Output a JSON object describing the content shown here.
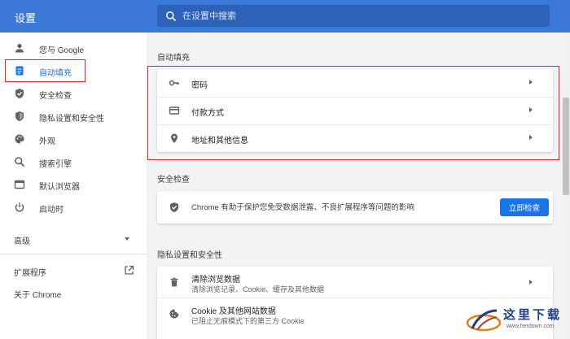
{
  "app": {
    "title": "设置"
  },
  "search": {
    "placeholder": "在设置中搜索"
  },
  "sidebar": {
    "items": [
      {
        "label": "您与 Google",
        "icon": "person-icon"
      },
      {
        "label": "自动填充",
        "icon": "autofill-icon",
        "active": true
      },
      {
        "label": "安全检查",
        "icon": "shield-check-icon"
      },
      {
        "label": "隐私设置和安全性",
        "icon": "shield-icon"
      },
      {
        "label": "外观",
        "icon": "palette-icon"
      },
      {
        "label": "搜索引擎",
        "icon": "search-icon"
      },
      {
        "label": "默认浏览器",
        "icon": "browser-icon"
      },
      {
        "label": "启动时",
        "icon": "power-icon"
      }
    ],
    "advanced": "高级",
    "extensions": "扩展程序",
    "about": "关于 Chrome"
  },
  "main": {
    "autofill": {
      "title": "自动填充",
      "rows": [
        {
          "label": "密码",
          "icon": "key-icon"
        },
        {
          "label": "付款方式",
          "icon": "credit-card-icon"
        },
        {
          "label": "地址和其他信息",
          "icon": "location-pin-icon"
        }
      ]
    },
    "safety": {
      "title": "安全检查",
      "text": "Chrome 有助于保护您免受数据泄露、不良扩展程序等问题的影响",
      "button": "立即检查"
    },
    "privacy": {
      "title": "隐私设置和安全性",
      "rows": [
        {
          "title": "清除浏览数据",
          "subtitle": "清除浏览记录、Cookie、缓存及其他数据",
          "icon": "trash-icon"
        },
        {
          "title": "Cookie 及其他网站数据",
          "subtitle": "已阻止无痕模式下的第三方 Cookie",
          "icon": "cookie-icon"
        }
      ]
    }
  },
  "watermark": {
    "text": "这里下载",
    "url": "www.herdown.com"
  },
  "colors": {
    "header": "#3c78d8",
    "accent": "#1a73e8",
    "highlight": "#e32323"
  }
}
